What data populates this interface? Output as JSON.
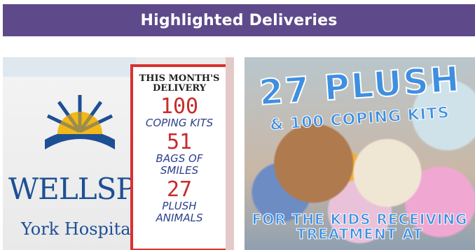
{
  "banner": {
    "title": "Highlighted Deliveries"
  },
  "cards": {
    "left": {
      "brand_name": "WELLSPAN",
      "brand_location": "York Hospital",
      "notice": {
        "heading_line1": "THIS MONTH'S",
        "heading_line2": "DELIVERY",
        "items": [
          {
            "count": "100",
            "label_line1": "COPING KITS",
            "label_line2": ""
          },
          {
            "count": "51",
            "label_line1": "BAGS OF",
            "label_line2": "SMILES"
          },
          {
            "count": "27",
            "label_line1": "PLUSH",
            "label_line2": "ANIMALS"
          }
        ]
      }
    },
    "right": {
      "title": "27 PLUSH",
      "subtitle": "& 100 COPING KITS",
      "footer_line1": "FOR THE KIDS RECEIVING",
      "footer_line2": "TREATMENT AT"
    }
  },
  "colors": {
    "banner": "#5e4a8b",
    "notice_border": "#d93230",
    "brand_blue": "#1d4f94",
    "poster_blue": "#3f8fe0"
  }
}
